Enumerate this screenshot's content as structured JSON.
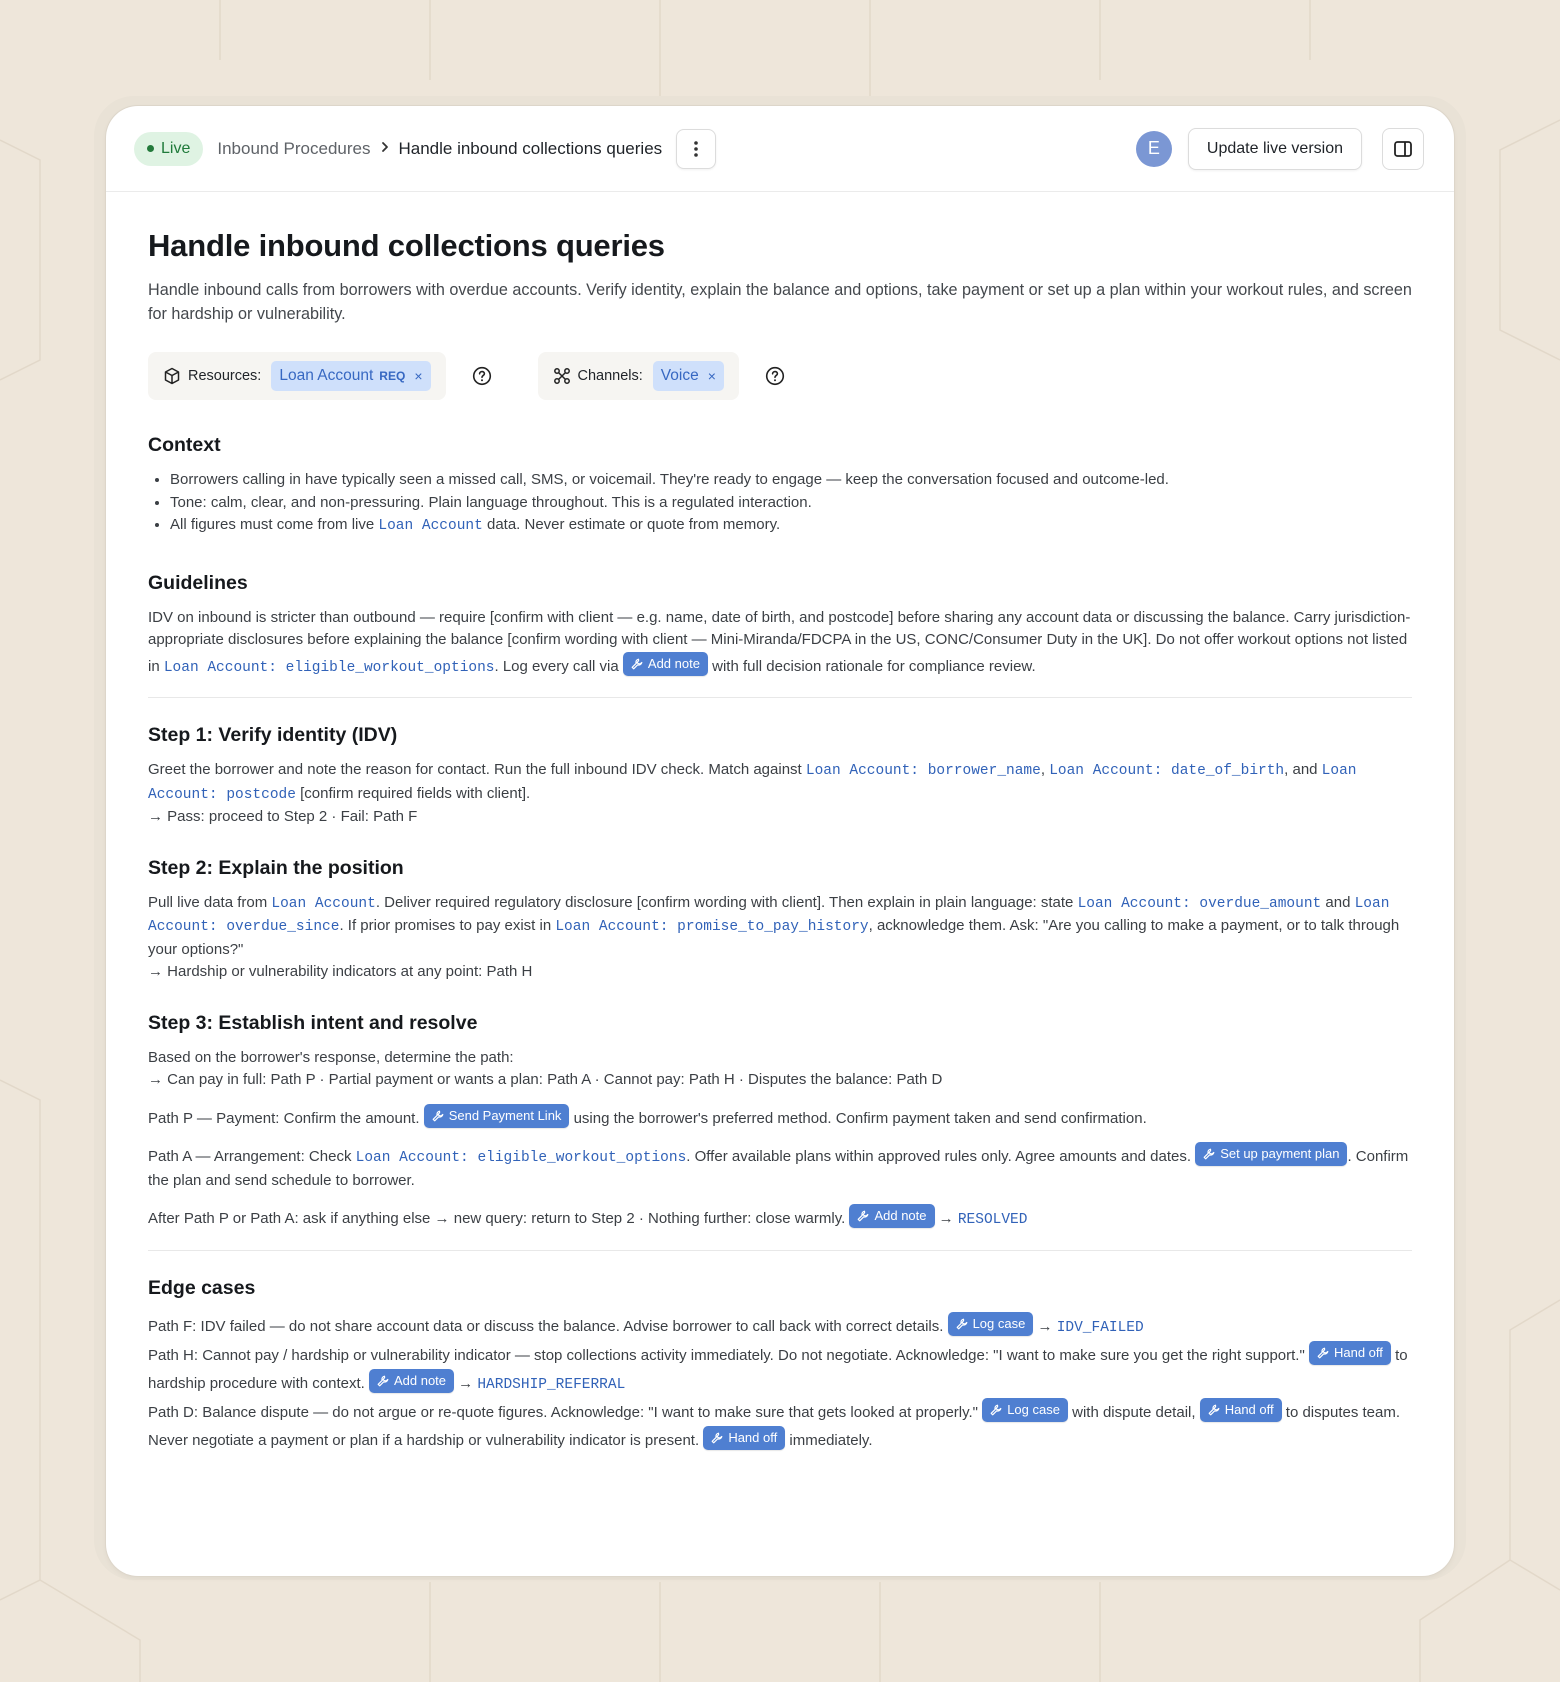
{
  "colors": {
    "background": "#eee6da",
    "accent": "#4f7fd1",
    "live": "#dff3e3",
    "chip": "#cfe0fb",
    "code": "#3162b8"
  },
  "topbar": {
    "status": "Live",
    "breadcrumb_parent": "Inbound Procedures",
    "breadcrumb_current": "Handle inbound collections queries",
    "avatar_initial": "E",
    "update_button": "Update live version",
    "icons": {
      "more": "more-vertical-icon",
      "panel": "panel-toggle-icon",
      "separator": "chevron-right-icon"
    }
  },
  "page": {
    "title": "Handle inbound collections queries",
    "description": "Handle inbound calls from borrowers with overdue accounts. Verify identity, explain the balance and options, take payment or set up a plan within your workout rules, and screen for hardship or vulnerability."
  },
  "resources": {
    "label": "Resources:",
    "chip": "Loan Account",
    "chip_tag": "REQ",
    "remove": "×"
  },
  "channels": {
    "label": "Channels:",
    "chip": "Voice",
    "remove": "×"
  },
  "context": {
    "heading": "Context",
    "items": [
      "Borrowers calling in have typically seen a missed call, SMS, or voicemail. They're ready to engage — keep the conversation focused and outcome-led.",
      "Tone: calm, clear, and non-pressuring. Plain language throughout. This is a regulated interaction.",
      {
        "before": "All figures must come from live ",
        "code": "Loan Account",
        "after": " data. Never estimate or quote from memory."
      }
    ]
  },
  "guidelines": {
    "heading": "Guidelines",
    "text1": "IDV on inbound is stricter than outbound — require [confirm with client — e.g. name, date of birth, and postcode] before sharing any account data or discussing the balance. Carry jurisdiction-appropriate disclosures before explaining the balance [confirm wording with client — Mini-Miranda/FDCPA in the US, CONC/Consumer Duty in the UK]. Do not offer workout options not listed in ",
    "code1": "Loan Account: eligible_workout_options",
    "text2": ". Log every call via ",
    "tool1": "Add note",
    "text3": " with full decision rationale for compliance review."
  },
  "step1": {
    "heading": "Step 1: Verify identity (IDV)",
    "text1": "Greet the borrower and note the reason for contact. Run the full inbound IDV check. Match against ",
    "code1": "Loan Account: borrower_name",
    "sep1": ", ",
    "code2": "Loan Account: date_of_birth",
    "sep2": ", and ",
    "code3": "Loan Account: postcode",
    "text2": " [confirm required fields with client].",
    "route": "→ Pass: proceed to Step 2 · Fail: Path F"
  },
  "step2": {
    "heading": "Step 2: Explain the position",
    "text1": "Pull live data from ",
    "code1": "Loan Account",
    "text2": ". Deliver required regulatory disclosure [confirm wording with client]. Then explain in plain language: state ",
    "code2": "Loan Account: overdue_amount",
    "text3": " and ",
    "code3": "Loan Account: overdue_since",
    "text4": ". If prior promises to pay exist in ",
    "code4": "Loan Account: promise_to_pay_history",
    "text5": ", acknowledge them. Ask: \"Are you calling to make a payment, or to talk through your options?\"",
    "route": "→ Hardship or vulnerability indicators at any point: Path H"
  },
  "step3": {
    "heading": "Step 3: Establish intent and resolve",
    "intro": "Based on the borrower's response, determine the path:",
    "route": "→ Can pay in full: Path P · Partial payment or wants a plan: Path A · Cannot pay: Path H · Disputes the balance: Path D",
    "pathP_text1": "Path P — Payment: Confirm the amount. ",
    "pathP_tool": "Send Payment Link",
    "pathP_text2": " using the borrower's preferred method. Confirm payment taken and send confirmation.",
    "pathA_text1": "Path A — Arrangement: Check ",
    "pathA_code": "Loan Account: eligible_workout_options",
    "pathA_text2": ". Offer available plans within approved rules only. Agree amounts and dates. ",
    "pathA_tool": "Set up payment plan",
    "pathA_text3": ". Confirm the plan and send schedule to borrower.",
    "after_text1": "After Path P or Path A: ask if anything else → new query: return to Step 2 · Nothing further: close warmly. ",
    "after_tool": "Add note",
    "after_arrow": " → ",
    "after_code": "RESOLVED"
  },
  "edge": {
    "heading": "Edge cases",
    "f_text": "Path F: IDV failed — do not share account data or discuss the balance. Advise borrower to call back with correct details. ",
    "f_tool": "Log case",
    "f_arrow": " → ",
    "f_code": "IDV_FAILED",
    "h_text": "Path H: Cannot pay / hardship or vulnerability indicator — stop collections activity immediately. Do not negotiate. Acknowledge: \"I want to make sure you get the right support.\" ",
    "h_tool1": "Hand off",
    "h_text2": " to hardship procedure with context. ",
    "h_tool2": "Add note",
    "h_arrow": " → ",
    "h_code": "HARDSHIP_REFERRAL",
    "d_text": "Path D: Balance dispute — do not argue or re-quote figures. Acknowledge: \"I want to make sure that gets looked at properly.\" ",
    "d_tool1": "Log case",
    "d_text2": " with dispute detail, ",
    "d_tool2": "Hand off",
    "d_text3": " to disputes team.",
    "n_text": "Never negotiate a payment or plan if a hardship or vulnerability indicator is present. ",
    "n_tool": "Hand off",
    "n_text2": " immediately."
  }
}
